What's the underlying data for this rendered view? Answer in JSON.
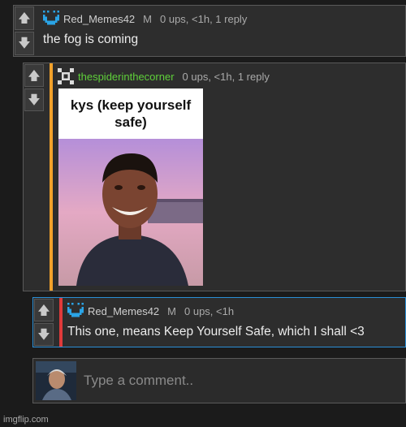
{
  "comments": [
    {
      "username": "Red_Memes42",
      "mod_badge": "M",
      "meta": "0 ups, <1h, 1 reply",
      "text": "the fog is coming",
      "username_color": "#cfcfcf"
    },
    {
      "username": "thespiderinthecorner",
      "meta": "0 ups, <1h, 1 reply",
      "username_color": "#5fcf3a",
      "bar_color": "#f2a12a",
      "image": {
        "caption": "kys (keep yourself safe)",
        "avatar_icon": "smiling-man-photo"
      }
    },
    {
      "username": "Red_Memes42",
      "mod_badge": "M",
      "meta": "0 ups, <1h",
      "text": "This one, means Keep Yourself Safe, which I shall <3",
      "username_color": "#cfcfcf",
      "bar_color": "#e03a3a",
      "border_color": "#2b8fd6"
    }
  ],
  "votes": {
    "up_icon": "arrow-up-icon",
    "down_icon": "arrow-down-icon"
  },
  "comment_box": {
    "placeholder": "Type a comment.."
  },
  "watermark": "imgflip.com",
  "colors": {
    "background": "#1b1b1b",
    "panel": "#2d2d2d",
    "icon_blue": "#2aa4e6"
  }
}
